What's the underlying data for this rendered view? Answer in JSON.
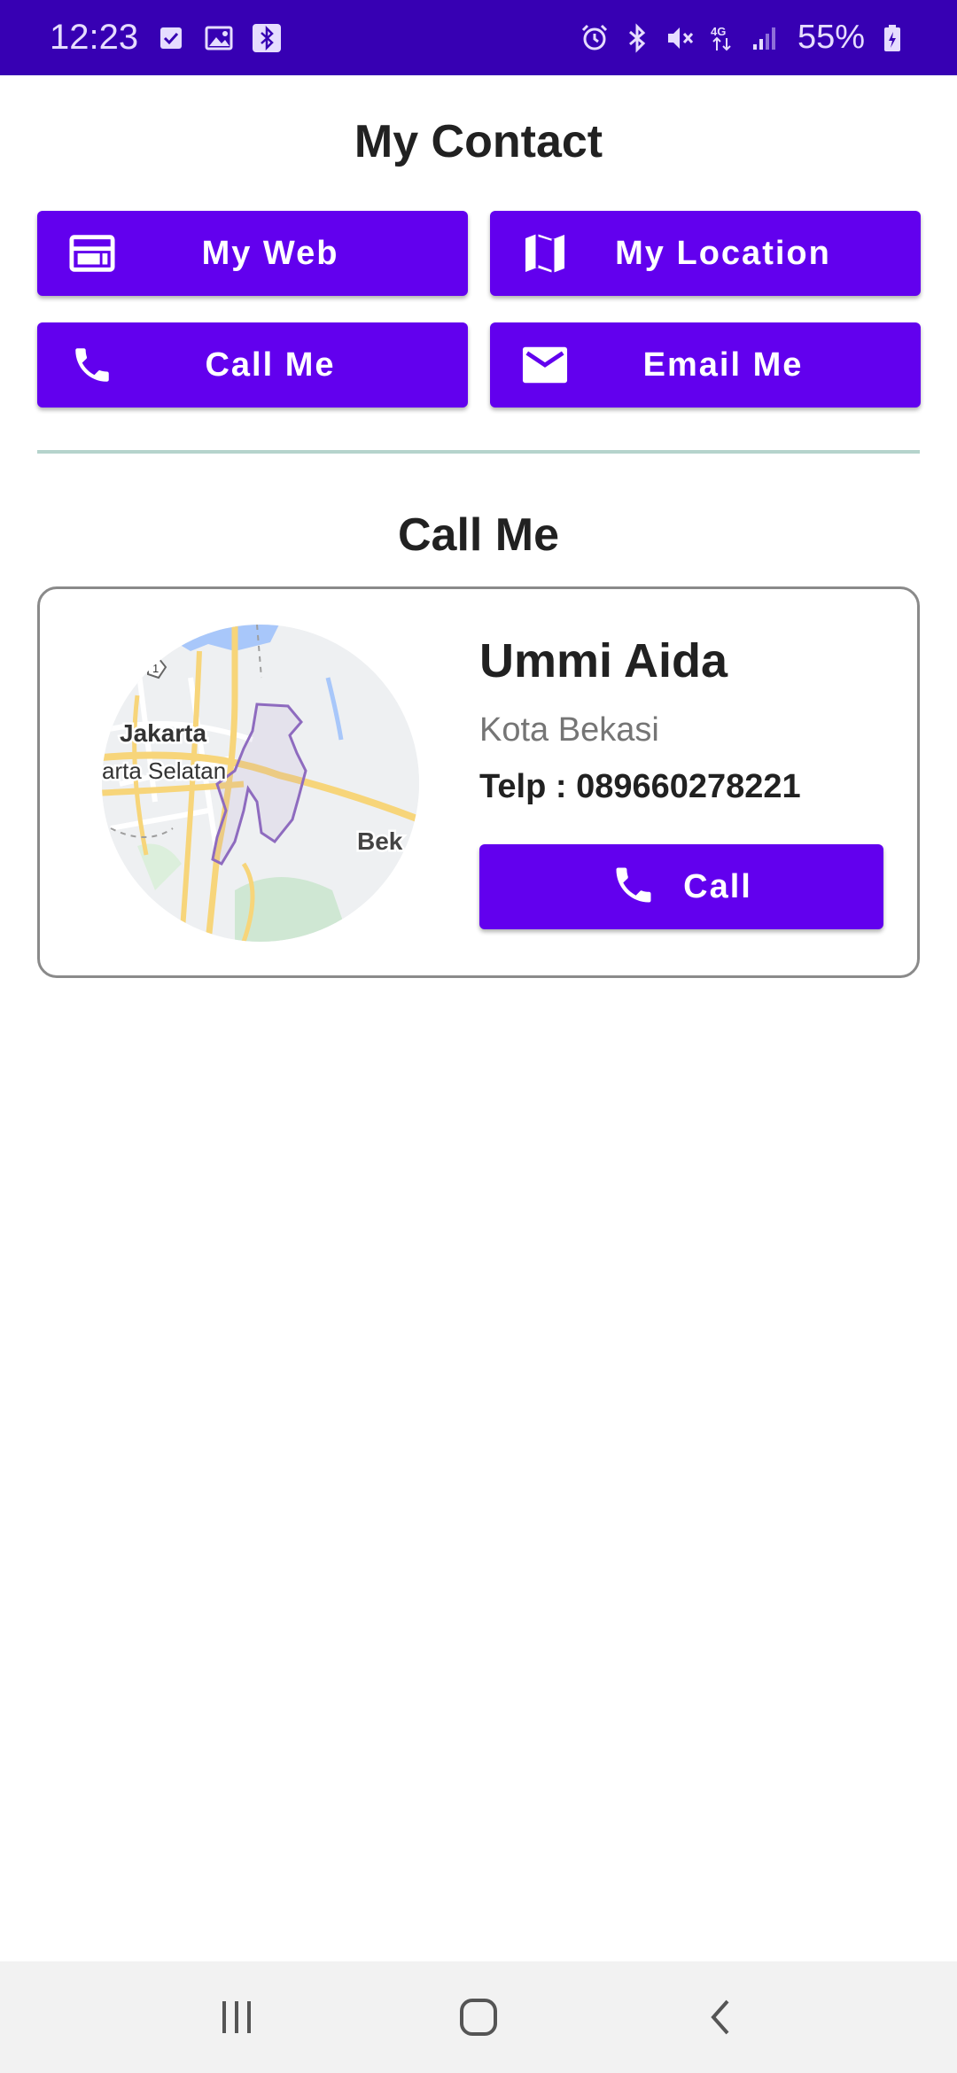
{
  "status_bar": {
    "time": "12:23",
    "battery": "55%",
    "icons_left": [
      "checkbox-icon",
      "image-icon",
      "bluetooth-icon"
    ],
    "icons_right": [
      "alarm-icon",
      "bluetooth-icon",
      "mute-icon",
      "4g-icon",
      "signal-icon",
      "battery-charging-icon"
    ],
    "background": "#3700B3"
  },
  "header": {
    "title": "My Contact"
  },
  "actions": [
    {
      "label": "My Web",
      "icon": "web-icon"
    },
    {
      "label": "My Location",
      "icon": "map-icon"
    },
    {
      "label": "Call Me",
      "icon": "phone-icon"
    },
    {
      "label": "Email Me",
      "icon": "email-icon"
    }
  ],
  "section": {
    "title": "Call Me"
  },
  "contact": {
    "name": "Ummi Aida",
    "city": "Kota Bekasi",
    "phone": "Telp : 089660278221",
    "call_label": "Call",
    "map_labels": [
      "Jakarta",
      "arta Selatan",
      "Bek"
    ]
  },
  "nav": [
    "recents-icon",
    "home-icon",
    "back-icon"
  ],
  "colors": {
    "primary": "#6200EE",
    "status": "#3700B3",
    "divider": "#b5d3cc"
  }
}
